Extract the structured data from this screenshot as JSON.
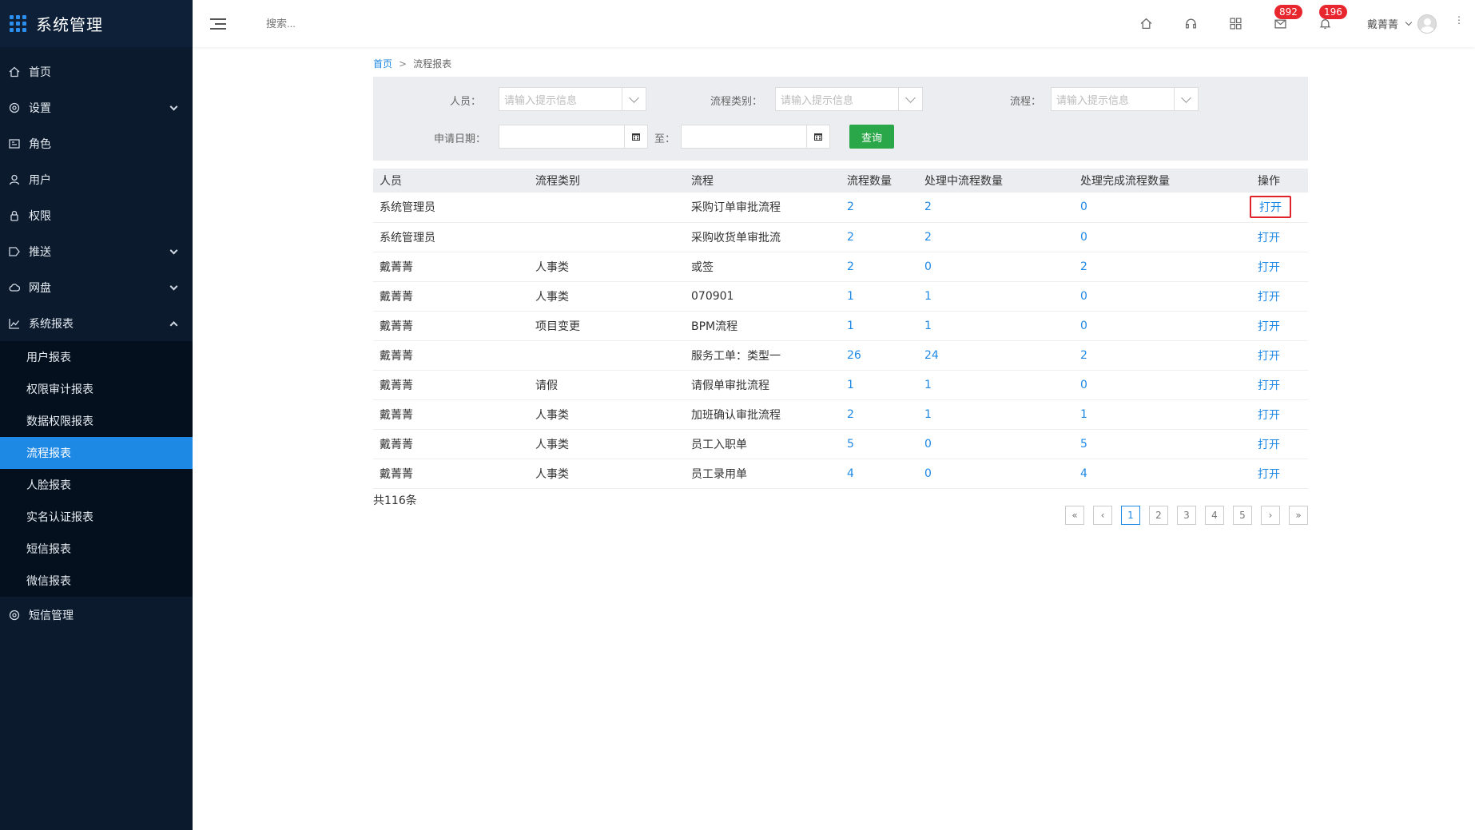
{
  "app": {
    "title": "系统管理"
  },
  "sidebar": {
    "items": [
      {
        "label": "首页"
      },
      {
        "label": "设置"
      },
      {
        "label": "角色"
      },
      {
        "label": "用户"
      },
      {
        "label": "权限"
      },
      {
        "label": "推送"
      },
      {
        "label": "网盘"
      },
      {
        "label": "系统报表"
      },
      {
        "label": "短信管理"
      }
    ],
    "reports_sub": [
      {
        "label": "用户报表"
      },
      {
        "label": "权限审计报表"
      },
      {
        "label": "数据权限报表"
      },
      {
        "label": "流程报表"
      },
      {
        "label": "人脸报表"
      },
      {
        "label": "实名认证报表"
      },
      {
        "label": "短信报表"
      },
      {
        "label": "微信报表"
      }
    ]
  },
  "topbar": {
    "search_placeholder": "搜索...",
    "mail_badge": "892",
    "bell_badge": "196",
    "username": "戴菁菁"
  },
  "breadcrumb": {
    "home": "首页",
    "sep": ">",
    "current": "流程报表"
  },
  "filters": {
    "person_label": "人员：",
    "category_label": "流程类别：",
    "process_label": "流程：",
    "placeholder": "请输入提示信息",
    "date_label": "申请日期：",
    "to_label": "至：",
    "query_button": "查询"
  },
  "table": {
    "headers": [
      "人员",
      "流程类别",
      "流程",
      "流程数量",
      "处理中流程数量",
      "处理完成流程数量",
      "操作"
    ],
    "rows": [
      {
        "person": "系统管理员",
        "category": "",
        "process": "采购订单审批流程",
        "count": "2",
        "pending": "2",
        "done": "0",
        "op": "打开"
      },
      {
        "person": "系统管理员",
        "category": "",
        "process": "采购收货单审批流",
        "count": "2",
        "pending": "2",
        "done": "0",
        "op": "打开"
      },
      {
        "person": "戴菁菁",
        "category": "人事类",
        "process": "或签",
        "count": "2",
        "pending": "0",
        "done": "2",
        "op": "打开"
      },
      {
        "person": "戴菁菁",
        "category": "人事类",
        "process": "070901",
        "count": "1",
        "pending": "1",
        "done": "0",
        "op": "打开"
      },
      {
        "person": "戴菁菁",
        "category": "项目变更",
        "process": "BPM流程",
        "count": "1",
        "pending": "1",
        "done": "0",
        "op": "打开"
      },
      {
        "person": "戴菁菁",
        "category": "",
        "process": "服务工单：类型一",
        "count": "26",
        "pending": "24",
        "done": "2",
        "op": "打开"
      },
      {
        "person": "戴菁菁",
        "category": "请假",
        "process": "请假单审批流程",
        "count": "1",
        "pending": "1",
        "done": "0",
        "op": "打开"
      },
      {
        "person": "戴菁菁",
        "category": "人事类",
        "process": "加班确认审批流程",
        "count": "2",
        "pending": "1",
        "done": "1",
        "op": "打开"
      },
      {
        "person": "戴菁菁",
        "category": "人事类",
        "process": "员工入职单",
        "count": "5",
        "pending": "0",
        "done": "5",
        "op": "打开"
      },
      {
        "person": "戴菁菁",
        "category": "人事类",
        "process": "员工录用单",
        "count": "4",
        "pending": "0",
        "done": "4",
        "op": "打开"
      }
    ]
  },
  "total": "共116条",
  "pagination": {
    "first": "«",
    "prev": "‹",
    "pages": [
      "1",
      "2",
      "3",
      "4",
      "5"
    ],
    "current": "1",
    "next": "›",
    "last": "»"
  },
  "colors": {
    "sidebar_bg": "#0b1a2d",
    "active_menu": "#1e88e5",
    "link": "#1e88e5",
    "query_button": "#2aa748",
    "badge": "#e8262e",
    "highlight_box": "#e0232b"
  }
}
